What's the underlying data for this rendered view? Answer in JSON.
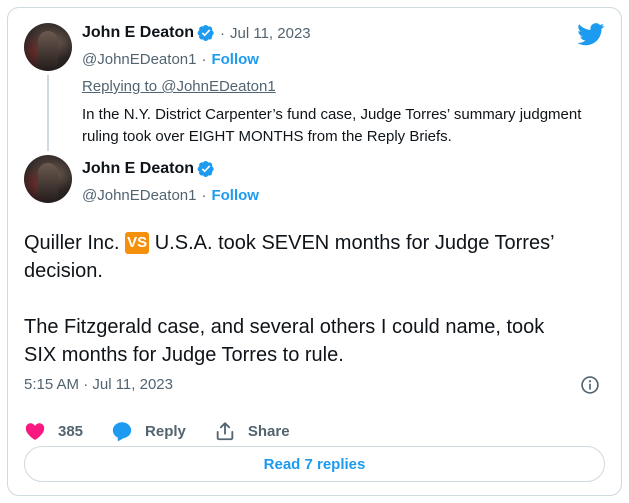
{
  "colors": {
    "accent": "#1d9bf0",
    "text": "#0f1419",
    "muted": "#536471",
    "border": "#cfd9de",
    "like": "#f91880",
    "vs_badge": "#f4900c"
  },
  "logo_icon": "twitter-bird-icon",
  "quoted_tweet": {
    "author_name": "John E Deaton",
    "verified_icon": "verified-badge-icon",
    "separator": "·",
    "date": "Jul 11, 2023",
    "handle": "@JohnEDeaton1",
    "handle_separator": "·",
    "follow_label": "Follow",
    "replying_to": "Replying to @JohnEDeaton1",
    "text": "In the N.Y. District Carpenter’s fund case, Judge Torres’ summary judgment ruling took over EIGHT MONTHS from the Reply Briefs."
  },
  "main_tweet": {
    "author_name": "John E Deaton",
    "verified_icon": "verified-badge-icon",
    "handle": "@JohnEDeaton1",
    "handle_separator": "·",
    "follow_label": "Follow",
    "text_line1_before": "Quiller Inc. ",
    "vs_badge": "VS",
    "text_line1_after": " U.S.A. took SEVEN months for Judge Torres’",
    "text_line2": "decision.",
    "text_line3": "The Fitzgerald case, and several  others I could name, took",
    "text_line4": "SIX months for Judge Torres to rule.",
    "timestamp": "5:15 AM · Jul 11, 2023",
    "info_icon": "info-icon"
  },
  "actions": {
    "like_count": "385",
    "reply_label": "Reply",
    "share_label": "Share"
  },
  "read_replies_label": "Read 7 replies"
}
